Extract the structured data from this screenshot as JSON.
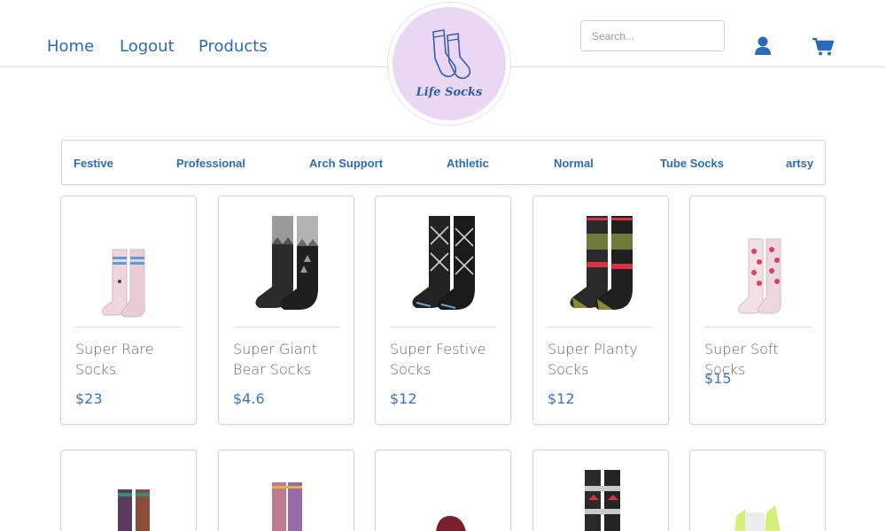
{
  "nav": {
    "home": "Home",
    "logout": "Logout",
    "products": "Products"
  },
  "logo": {
    "text": "Life Socks"
  },
  "search": {
    "placeholder": "Search..."
  },
  "icons": {
    "user": "user-icon",
    "cart": "cart-icon"
  },
  "colors": {
    "accent": "#2a6bb8",
    "logo_bg": "#ead7f4",
    "price": "#3b73c0"
  },
  "categories": [
    "Festive",
    "Professional",
    "Arch Support",
    "Athletic",
    "Normal",
    "Tube Socks",
    "artsy"
  ],
  "products": [
    {
      "name": "Super Rare Socks",
      "price": "$23"
    },
    {
      "name": "Super Giant Bear Socks",
      "price": "$4.6"
    },
    {
      "name": "Super Festive Socks",
      "price": "$12"
    },
    {
      "name": "Super Planty Socks",
      "price": "$12"
    },
    {
      "name": "Super Soft Socks",
      "price": "$15"
    }
  ]
}
